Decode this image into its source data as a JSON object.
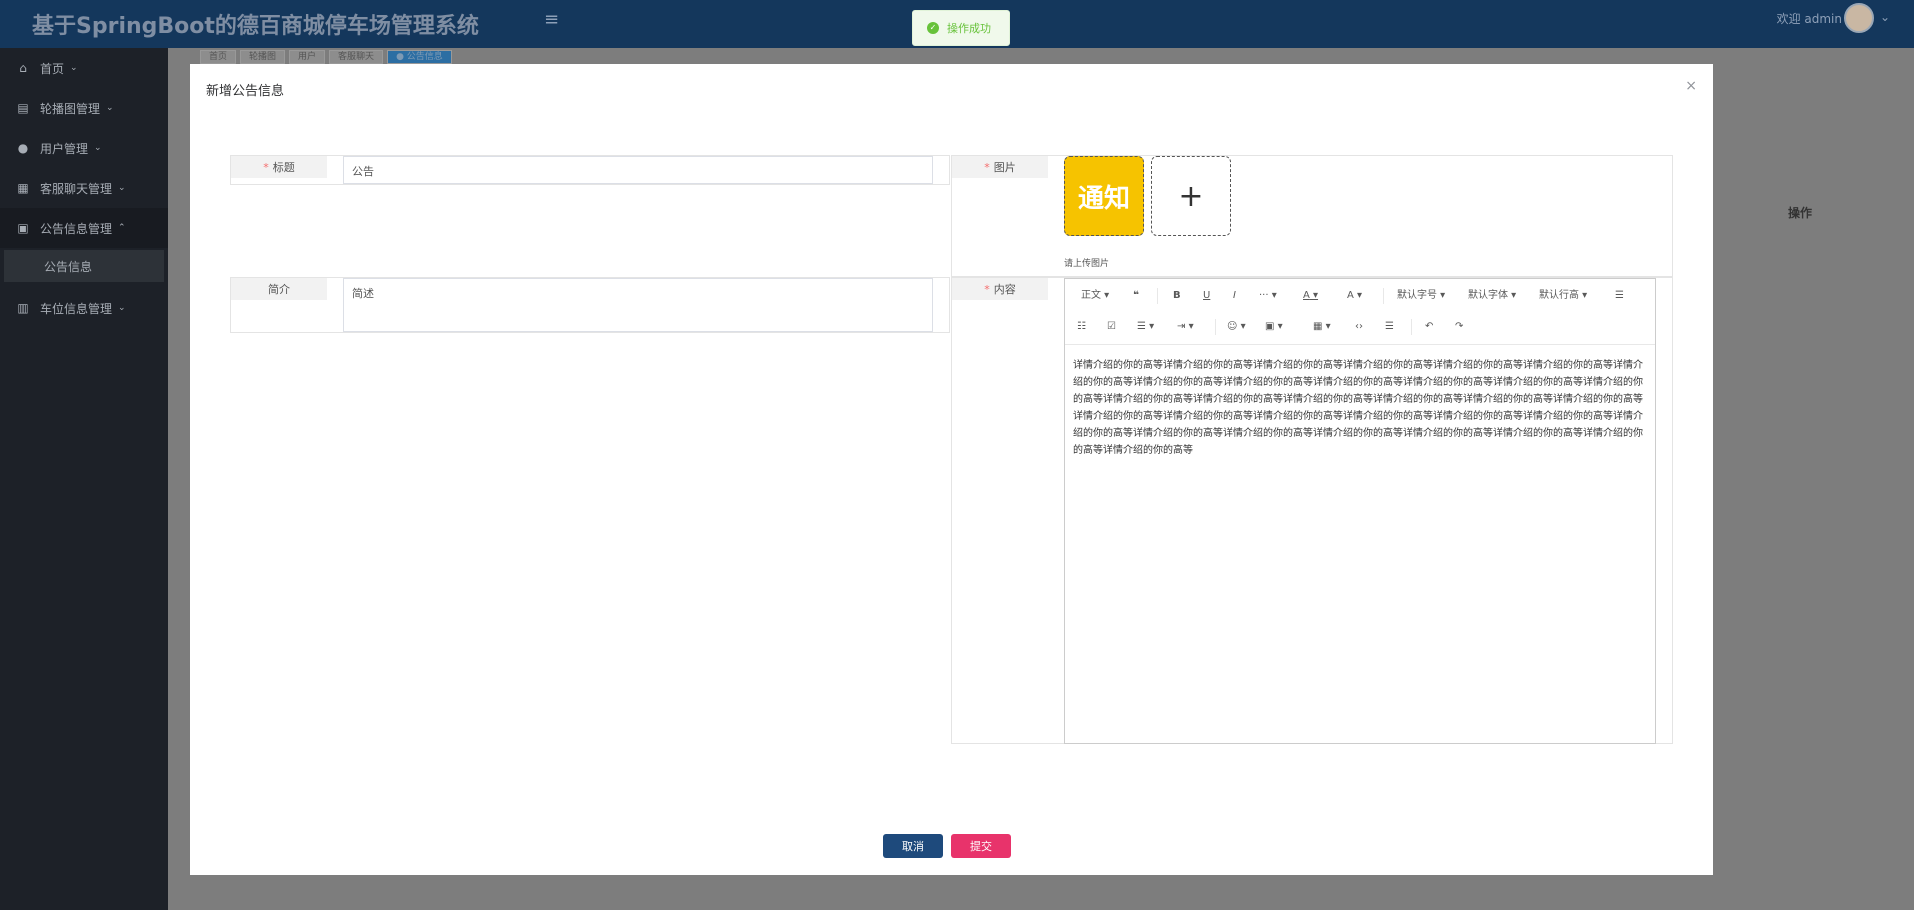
{
  "header": {
    "title": "基于SpringBoot的德百商城停车场管理系统",
    "welcome": "欢迎 admin",
    "menu_icon": "hamburger-icon"
  },
  "sidebar": {
    "items": [
      {
        "label": "首页",
        "icon": "home-icon"
      },
      {
        "label": "轮播图管理",
        "icon": "grid-icon"
      },
      {
        "label": "用户管理",
        "icon": "user-icon"
      },
      {
        "label": "客服聊天管理",
        "icon": "dashboard-icon"
      },
      {
        "label": "公告信息管理",
        "icon": "gift-icon"
      },
      {
        "label": "车位信息管理",
        "icon": "chart-icon"
      }
    ],
    "sub_item": "公告信息"
  },
  "tabs": [
    "首页",
    "轮播图",
    "用户",
    "客服聊天",
    "● 公告信息"
  ],
  "toast": {
    "text": "操作成功"
  },
  "table": {
    "op_header": "操作"
  },
  "modal": {
    "title": "新增公告信息",
    "close": "×",
    "fields": {
      "title": {
        "label": "标题",
        "value": "公告"
      },
      "image": {
        "label": "图片",
        "thumb_text": "通知",
        "hint": "请上传图片"
      },
      "intro": {
        "label": "简介",
        "value": "简述"
      },
      "content": {
        "label": "内容"
      }
    },
    "editor": {
      "toolbar": {
        "paragraph": "正文",
        "quote": "❝",
        "bold": "B",
        "underline": "U",
        "italic": "I",
        "more": "···",
        "font_color": "A",
        "bg_color": "A",
        "font_size": "默认字号",
        "font_family": "默认字体",
        "line_height": "默认行高",
        "bullet_list": "☰",
        "numbered_list": "☷",
        "todo": "☑",
        "align": "☰",
        "indent": "⇥",
        "emoji": "☺",
        "image": "▣",
        "table": "▦",
        "code": "‹›",
        "divider": "☰",
        "undo": "↶",
        "redo": "↷"
      },
      "content": "详情介绍的你的高等详情介绍的你的高等详情介绍的你的高等详情介绍的你的高等详情介绍的你的高等详情介绍的你的高等详情介绍的你的高等详情介绍的你的高等详情介绍的你的高等详情介绍的你的高等详情介绍的你的高等详情介绍的你的高等详情介绍的你的高等详情介绍的你的高等详情介绍的你的高等详情介绍的你的高等详情介绍的你的高等详情介绍的你的高等详情介绍的你的高等详情介绍的你的高等详情介绍的你的高等详情介绍的你的高等详情介绍的你的高等详情介绍的你的高等详情介绍的你的高等详情介绍的你的高等详情介绍的你的高等详情介绍的你的高等详情介绍的你的高等详情介绍的你的高等详情介绍的你的高等详情介绍的你的高等详情介绍的你的高等"
    },
    "buttons": {
      "cancel": "取消",
      "submit": "提交"
    }
  }
}
